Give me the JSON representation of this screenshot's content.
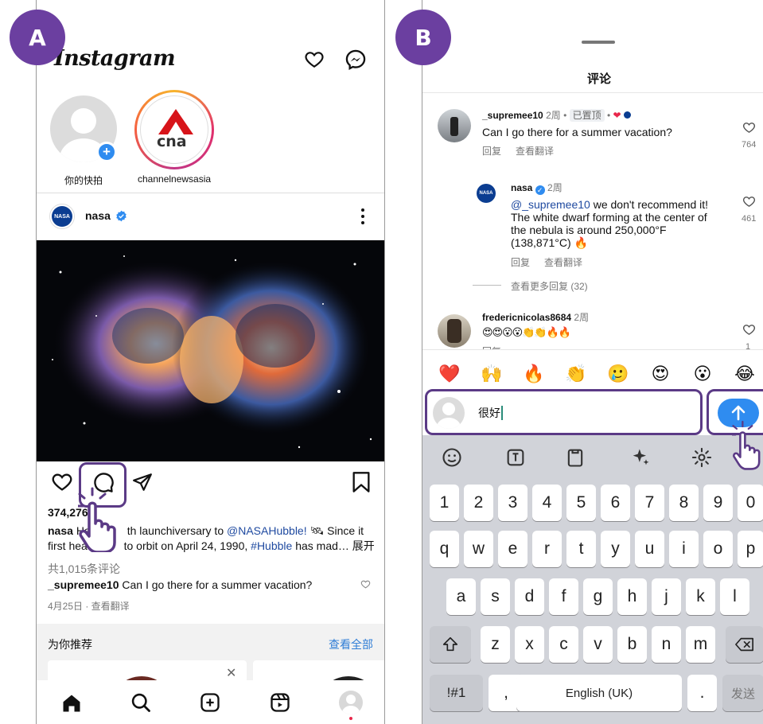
{
  "badges": {
    "a": "A",
    "b": "B"
  },
  "feed": {
    "logo": "Instagram",
    "stories": [
      {
        "label": "你的快拍"
      },
      {
        "label": "channelnewsasia",
        "logo_text": "cna"
      }
    ],
    "post": {
      "user": "nasa",
      "likes": "374,276",
      "caption_user": "nasa",
      "caption_a": "Ha",
      "caption_b": "th launchiversary to",
      "caption_mention": "@NASAHubble!",
      "caption_c": "🛰 Since it",
      "caption_line2a": "first head",
      "caption_line2b": "to orbit on April 24, 1990,",
      "caption_hashtag": "#Hubble",
      "caption_line2c": "has mad…",
      "caption_more": "展开",
      "comment_count": "共1,015条评论",
      "top_comment_user": "_supremee10",
      "top_comment_text": "Can I go there for a summer vacation?",
      "date": "4月25日 · 查看翻译"
    },
    "suggest_title": "为你推荐",
    "suggest_link": "查看全部"
  },
  "comments_sheet": {
    "title": "评论",
    "comments": [
      {
        "user": "_supremee10",
        "time": "2周",
        "tag": "已置顶",
        "text": "Can I go there for a summer vacation?",
        "reply": "回复",
        "translate": "查看翻译",
        "likes": "764"
      },
      {
        "user": "nasa",
        "time": "2周",
        "mention": "@_supremee10",
        "text1": "we don't recommend it!",
        "text2": "The white dwarf forming at the center of",
        "text3": "the nebula is around 250,000°F",
        "text4": "(138,871°C) 🔥",
        "reply": "回复",
        "translate": "查看翻译",
        "likes": "461"
      },
      {
        "user": "fredericnicolas8684",
        "time": "2周",
        "text": "😍😍😮😮👏👏🔥🔥",
        "reply": "回复",
        "likes": "1"
      }
    ],
    "more_replies": "查看更多回复 (32)",
    "emojis": [
      "❤️",
      "🙌",
      "🔥",
      "👏",
      "🥲",
      "😍",
      "😮",
      "😂"
    ],
    "input_value": "很好"
  },
  "keyboard": {
    "numbers": [
      "1",
      "2",
      "3",
      "4",
      "5",
      "6",
      "7",
      "8",
      "9",
      "0"
    ],
    "row1": [
      "q",
      "w",
      "e",
      "r",
      "t",
      "y",
      "u",
      "i",
      "o",
      "p"
    ],
    "row2": [
      "a",
      "s",
      "d",
      "f",
      "g",
      "h",
      "j",
      "k",
      "l"
    ],
    "row3": [
      "z",
      "x",
      "c",
      "v",
      "b",
      "n",
      "m"
    ],
    "symbols": "!#1",
    "comma": ",",
    "space": "English (UK)",
    "period": ".",
    "send": "发送"
  }
}
